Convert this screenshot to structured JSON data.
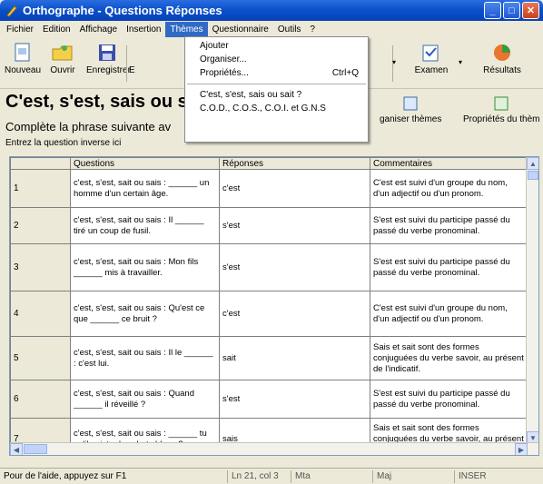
{
  "window": {
    "title": "Orthographe - Questions Réponses"
  },
  "menu": [
    "Fichier",
    "Edition",
    "Affichage",
    "Insertion",
    "Thèmes",
    "Questionnaire",
    "Outils",
    "?"
  ],
  "toolbar": {
    "new": "Nouveau",
    "open": "Ouvrir",
    "save": "Enregistrer",
    "partial": "E",
    "exam": "Examen",
    "results": "Résultats"
  },
  "dropdown": {
    "items": [
      "Ajouter",
      "Organiser...",
      "Propriétés..."
    ],
    "shortcut": "Ctrl+Q",
    "themes": [
      "C'est, s'est, sais ou sait ?",
      "C.O.D., C.O.S., C.O.I. et G.N.S"
    ]
  },
  "page": {
    "heading": "C'est, s'est, sais ou s",
    "instruction": "Complète la phrase suivante av",
    "hint": "Entrez la question inverse ici"
  },
  "right_buttons": {
    "organise": "ganiser thèmes",
    "props": "Propriétés du thèm"
  },
  "table": {
    "headers": [
      "Questions",
      "Réponses",
      "Commentaires"
    ],
    "rows": [
      {
        "n": "1",
        "q": "c'est, s'est, sait ou sais : ______ un homme d'un certain âge.",
        "r": "c'est",
        "c": "C'est est suivi d'un groupe du nom, d'un adjectif ou d'un pronom."
      },
      {
        "n": "2",
        "q": "c'est, s'est, sait ou sais : Il ______ tiré un coup de fusil.",
        "r": "s'est",
        "c": "S'est est suivi du participe passé du passé du verbe pronominal."
      },
      {
        "n": "3",
        "q": "c'est, s'est, sait ou sais : Mon fils ______ mis à travailler.",
        "r": "s'est",
        "c": "S'est est suivi du participe passé du passé du verbe pronominal."
      },
      {
        "n": "4",
        "q": "c'est, s'est, sait ou sais : Qu'est ce que ______ ce bruit ?",
        "r": "c'est",
        "c": "C'est est suivi d'un groupe du nom, d'un adjectif ou d'un pronom."
      },
      {
        "n": "5",
        "q": "c'est, s'est, sait ou sais : Il le ______ : c'est lui.",
        "r": "sait",
        "c": "Sais et sait sont des formes conjuguées du verbe savoir, au présent de l'indicatif."
      },
      {
        "n": "6",
        "q": "c'est, s'est, sait ou sais : Quand ______ il réveillé ?",
        "r": "s'est",
        "c": "S'est est suivi du participe passé du passé du verbe pronominal."
      },
      {
        "n": "7",
        "q": "c'est, s'est, sait ou sais : ______ tu qu'il existe des chats bleus ?",
        "r": "sais",
        "c": "Sais et sait sont des formes conjuguées du verbe savoir, au présent de l'indicatif."
      }
    ]
  },
  "status": {
    "help": "Pour de l'aide, appuyez sur F1",
    "pos": "Ln 21, col 3",
    "c3": "Mta",
    "c4": "Maj",
    "c5": "INSER"
  }
}
